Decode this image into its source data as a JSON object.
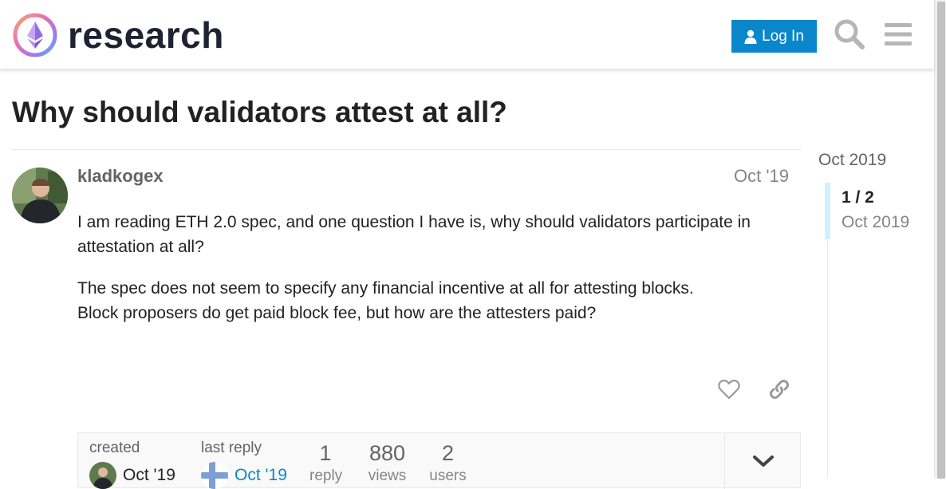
{
  "header": {
    "logo_text": "research",
    "login_label": "Log In"
  },
  "topic": {
    "title": "Why should validators attest at all?"
  },
  "post": {
    "username": "kladkogex",
    "date": "Oct '19",
    "paragraph1": "I am reading ETH 2.0 spec, and one question I have is, why should validators participate in attestation at all?",
    "paragraph2_line1": "The spec does not seem to specify any financial incentive at all for attesting blocks.",
    "paragraph2_line2": "Block proposers do get paid block fee, but how are the attesters paid?"
  },
  "topic_map": {
    "created_label": "created",
    "created_date": "Oct '19",
    "last_reply_label": "last reply",
    "last_reply_date": "Oct '19",
    "replies_count": "1",
    "replies_label": "reply",
    "views_count": "880",
    "views_label": "views",
    "users_count": "2",
    "users_label": "users"
  },
  "timeline": {
    "top_date": "Oct 2019",
    "position": "1 / 2",
    "position_date": "Oct 2019"
  },
  "icons": {
    "logo": "research-logo-icon",
    "login": "user-icon",
    "search": "search-icon",
    "menu": "hamburger-menu-icon",
    "like": "heart-icon",
    "share": "link-icon",
    "expand": "chevron-down-icon"
  },
  "colors": {
    "accent": "#0a87ca",
    "timeline_handle": "#d1f0ff"
  }
}
